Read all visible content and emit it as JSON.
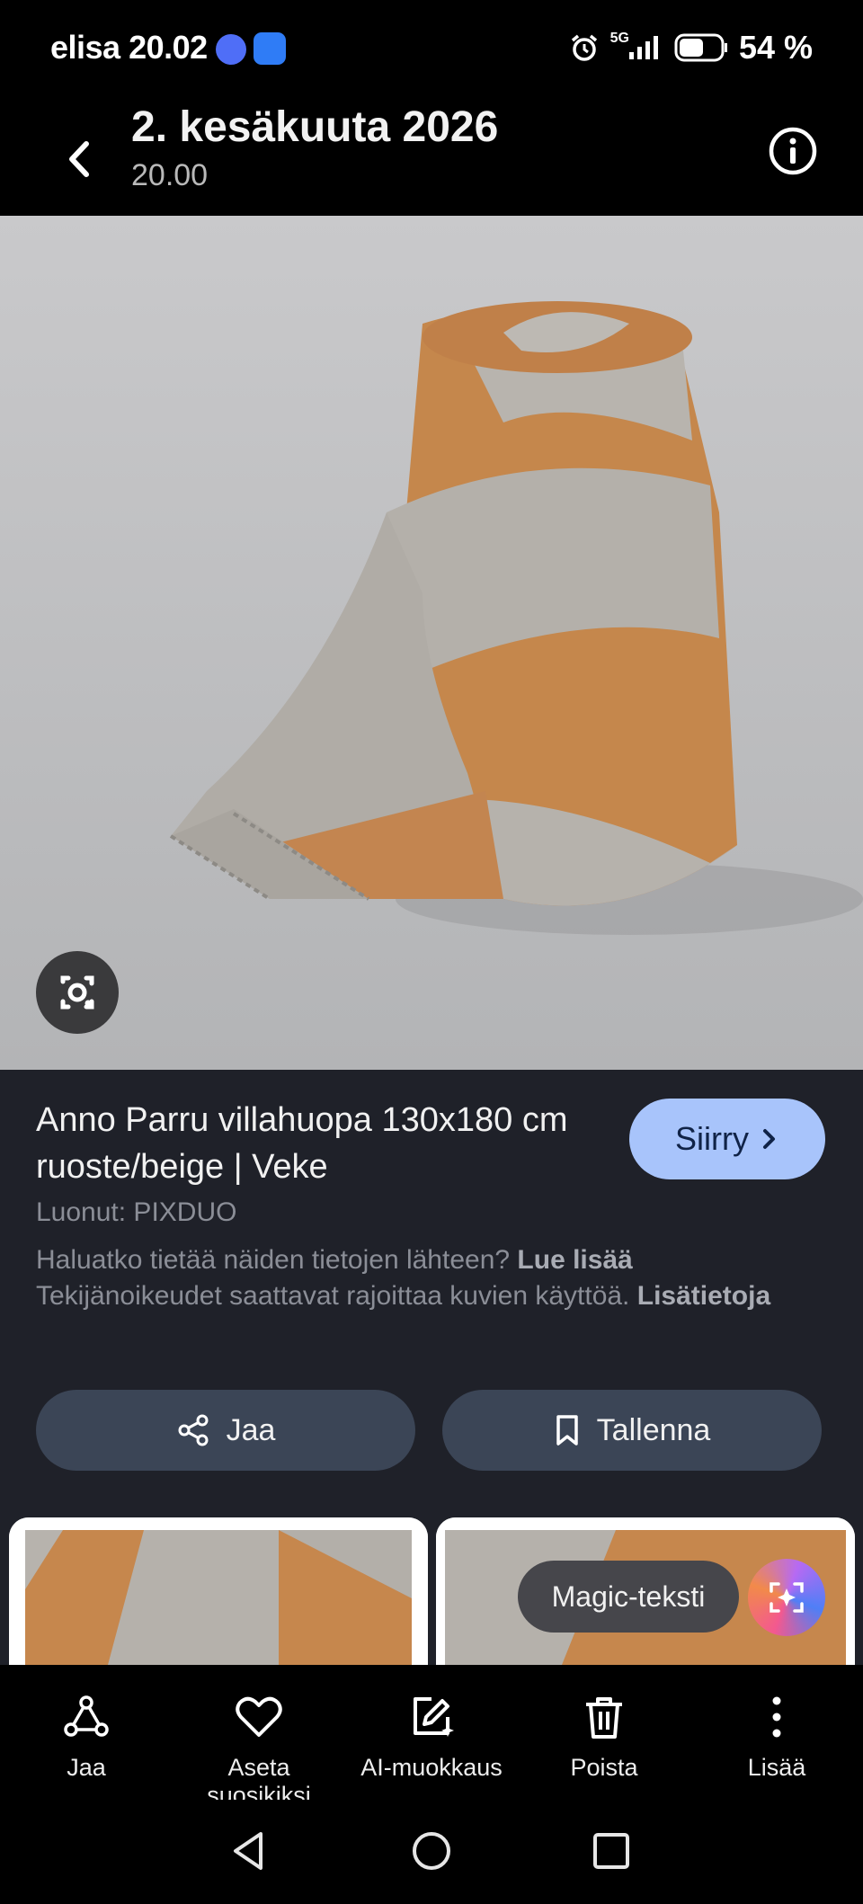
{
  "status_bar": {
    "carrier": "elisa",
    "time": "20.02",
    "network": "5G",
    "battery": "54 %"
  },
  "header": {
    "title": "2. kesäkuuta 2026",
    "subtitle": "20.00",
    "back_icon": "back-arrow-icon",
    "info_icon": "info-icon"
  },
  "result": {
    "title": "Anno Parru villahuopa 130x180 cm ruoste/beige | Veke",
    "go_button": "Siirry",
    "creator": "Luonut: PIXDUO",
    "source_question": "Haluatko tietää näiden tietojen lähteen?",
    "source_link": "Lue lisää",
    "copyright_text": "Tekijänoikeudet saattavat rajoittaa kuvien käyttöä.",
    "copyright_link": "Lisätietoja",
    "share_button": "Jaa",
    "save_button": "Tallenna",
    "magic_text": "Magic-teksti"
  },
  "toolbar": {
    "items": [
      {
        "label": "Jaa",
        "icon": "share-icon"
      },
      {
        "label": "Aseta suosikiksi",
        "icon": "heart-icon"
      },
      {
        "label": "AI-muokkaus",
        "icon": "ai-edit-icon"
      },
      {
        "label": "Poista",
        "icon": "trash-icon"
      },
      {
        "label": "Lisää",
        "icon": "more-icon"
      }
    ]
  },
  "colors": {
    "panel_bg": "#1f2129",
    "pill_bg": "#3b4556",
    "go_button_bg": "#a8c4fb",
    "rust": "#c5874c",
    "beige": "#b4b0aa"
  }
}
